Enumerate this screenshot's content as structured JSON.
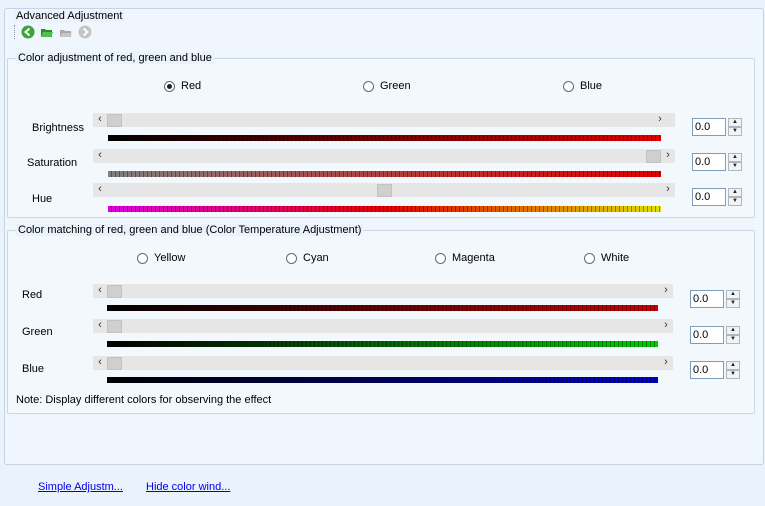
{
  "window": {
    "title": "Advanced Adjustment"
  },
  "toolbar": {
    "icons": [
      "back-icon",
      "open-folder-icon",
      "save-icon",
      "reset-icon"
    ]
  },
  "rgb_section": {
    "title": "Color adjustment of red, green and blue",
    "radios": [
      {
        "label": "Red",
        "checked": true
      },
      {
        "label": "Green",
        "checked": false
      },
      {
        "label": "Blue",
        "checked": false
      }
    ],
    "rows": [
      {
        "label": "Brightness",
        "value": "0.0",
        "slider_fraction": 0.0
      },
      {
        "label": "Saturation",
        "value": "0.0",
        "slider_fraction": 1.0
      },
      {
        "label": "Hue",
        "value": "0.0",
        "slider_fraction": 0.5
      }
    ]
  },
  "temp_section": {
    "title": "Color matching of red, green and blue (Color Temperature Adjustment)",
    "radios": [
      {
        "label": "Yellow",
        "checked": false
      },
      {
        "label": "Cyan",
        "checked": false
      },
      {
        "label": "Magenta",
        "checked": false
      },
      {
        "label": "White",
        "checked": false
      }
    ],
    "rows": [
      {
        "label": "Red",
        "value": "0.0",
        "slider_fraction": 0.0
      },
      {
        "label": "Green",
        "value": "0.0",
        "slider_fraction": 0.0
      },
      {
        "label": "Blue",
        "value": "0.0",
        "slider_fraction": 0.0
      }
    ],
    "note": "Note: Display different colors for observing the effect"
  },
  "arrows": {
    "left": "‹",
    "right": "›",
    "up": "▲",
    "down": "▼"
  },
  "links": {
    "simple": "Simple Adjustm...",
    "hide": "Hide color wind..."
  },
  "colors": {
    "brightness": "#e00000",
    "saturation_start": "#808080",
    "saturation_end": "#e00000",
    "temp_red": "#cc0000",
    "temp_green": "#00cc00",
    "temp_blue": "#0000cc"
  }
}
